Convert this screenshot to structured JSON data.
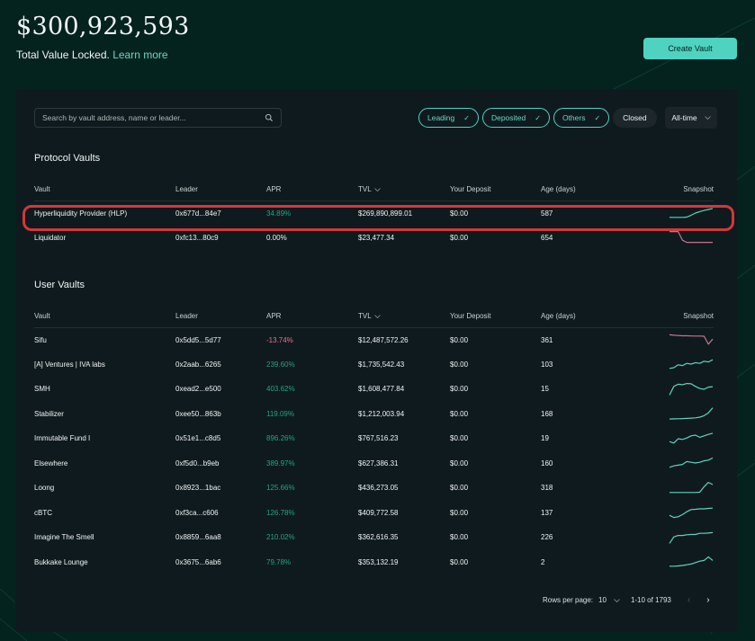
{
  "header": {
    "total_value_locked": "$300,923,593",
    "subtitle": "Total Value Locked.",
    "learn_more": "Learn more"
  },
  "create_vault_label": "Create Vault",
  "search": {
    "placeholder": "Search by vault address, name or leader...",
    "value": ""
  },
  "filters": [
    {
      "label": "Leading",
      "checked": true
    },
    {
      "label": "Deposited",
      "checked": true
    },
    {
      "label": "Others",
      "checked": true
    },
    {
      "label": "Closed",
      "checked": false
    }
  ],
  "time_range": "All-time",
  "columns": [
    "Vault",
    "Leader",
    "APR",
    "TVL",
    "Your Deposit",
    "Age (days)",
    "Snapshot"
  ],
  "colors": {
    "accent": "#50d2c1",
    "positive": "#1fa67d",
    "negative": "#ed7088",
    "highlight": "#d3373a"
  },
  "protocol_vaults": {
    "title": "Protocol Vaults",
    "rows": [
      {
        "vault": "Hyperliquidity Provider (HLP)",
        "leader": "0x677d...84e7",
        "apr": "34.89%",
        "apr_sign": "pos",
        "tvl": "$269,890,899.01",
        "deposit": "$0.00",
        "age": "587",
        "trend": "up",
        "snapshot": [
          0.2,
          0.2,
          0.2,
          0.2,
          0.22,
          0.35,
          0.5,
          0.6,
          0.68,
          0.75,
          0.82
        ]
      },
      {
        "vault": "Liquidator",
        "leader": "0xfc13...80c9",
        "apr": "0.00%",
        "apr_sign": "neutral",
        "tvl": "$23,477.34",
        "deposit": "$0.00",
        "age": "654",
        "trend": "down",
        "snapshot": [
          0.9,
          0.9,
          0.9,
          0.3,
          0.15,
          0.15,
          0.15,
          0.15,
          0.15,
          0.15,
          0.15
        ]
      }
    ]
  },
  "user_vaults": {
    "title": "User Vaults",
    "rows": [
      {
        "vault": "Sifu",
        "leader": "0x5dd5...5d77",
        "apr": "-13.74%",
        "apr_sign": "neg",
        "tvl": "$12,487,572.26",
        "deposit": "$0.00",
        "age": "361",
        "trend": "down",
        "snapshot": [
          0.85,
          0.82,
          0.8,
          0.78,
          0.78,
          0.77,
          0.76,
          0.76,
          0.75,
          0.2,
          0.55
        ]
      },
      {
        "vault": "[A] Ventures | IVA labs",
        "leader": "0x2aab...6265",
        "apr": "239.60%",
        "apr_sign": "pos",
        "tvl": "$1,735,542.43",
        "deposit": "$0.00",
        "age": "103",
        "trend": "up",
        "snapshot": [
          0.2,
          0.25,
          0.45,
          0.4,
          0.55,
          0.5,
          0.6,
          0.55,
          0.7,
          0.65,
          0.8
        ]
      },
      {
        "vault": "SMH",
        "leader": "0xead2...e500",
        "apr": "403.62%",
        "apr_sign": "pos",
        "tvl": "$1,608,477.84",
        "deposit": "$0.00",
        "age": "15",
        "trend": "up",
        "snapshot": [
          0.1,
          0.7,
          0.85,
          0.82,
          0.9,
          0.88,
          0.7,
          0.55,
          0.5,
          0.65,
          0.68
        ]
      },
      {
        "vault": "Stabilizer",
        "leader": "0xee50...863b",
        "apr": "119.09%",
        "apr_sign": "pos",
        "tvl": "$1,212,003.94",
        "deposit": "$0.00",
        "age": "168",
        "trend": "up",
        "snapshot": [
          0.12,
          0.13,
          0.14,
          0.15,
          0.16,
          0.18,
          0.2,
          0.25,
          0.35,
          0.55,
          0.9
        ]
      },
      {
        "vault": "Immutable Fund I",
        "leader": "0x51e1...c8d5",
        "apr": "896.26%",
        "apr_sign": "pos",
        "tvl": "$767,516.23",
        "deposit": "$0.00",
        "age": "19",
        "trend": "up",
        "snapshot": [
          0.3,
          0.2,
          0.5,
          0.45,
          0.55,
          0.7,
          0.75,
          0.6,
          0.7,
          0.8,
          0.88
        ]
      },
      {
        "vault": "Elsewhere",
        "leader": "0xf5d0...b9eb",
        "apr": "389.97%",
        "apr_sign": "pos",
        "tvl": "$627,386.31",
        "deposit": "$0.00",
        "age": "160",
        "trend": "up",
        "snapshot": [
          0.2,
          0.3,
          0.35,
          0.4,
          0.6,
          0.55,
          0.5,
          0.55,
          0.65,
          0.7,
          0.85
        ]
      },
      {
        "vault": "Loong",
        "leader": "0x8923...1bac",
        "apr": "125.66%",
        "apr_sign": "pos",
        "tvl": "$436,273.05",
        "deposit": "$0.00",
        "age": "318",
        "trend": "up",
        "snapshot": [
          0.2,
          0.2,
          0.2,
          0.2,
          0.2,
          0.2,
          0.2,
          0.22,
          0.6,
          0.9,
          0.75
        ]
      },
      {
        "vault": "cBTC",
        "leader": "0xf3ca...c606",
        "apr": "126.78%",
        "apr_sign": "pos",
        "tvl": "$409,772.58",
        "deposit": "$0.00",
        "age": "137",
        "trend": "up",
        "snapshot": [
          0.3,
          0.15,
          0.2,
          0.35,
          0.55,
          0.7,
          0.72,
          0.75,
          0.75,
          0.78,
          0.8
        ]
      },
      {
        "vault": "Imagine The Smell",
        "leader": "0x8859...6aa8",
        "apr": "210.02%",
        "apr_sign": "pos",
        "tvl": "$362,616.35",
        "deposit": "$0.00",
        "age": "226",
        "trend": "up",
        "snapshot": [
          0.1,
          0.55,
          0.65,
          0.65,
          0.7,
          0.72,
          0.72,
          0.8,
          0.8,
          0.82,
          0.85
        ]
      },
      {
        "vault": "Bukkake Lounge",
        "leader": "0x3675...6ab6",
        "apr": "79.78%",
        "apr_sign": "pos",
        "tvl": "$353,132.19",
        "deposit": "$0.00",
        "age": "2",
        "trend": "up",
        "snapshot": [
          0.2,
          0.2,
          0.22,
          0.25,
          0.3,
          0.35,
          0.45,
          0.55,
          0.6,
          0.85,
          0.6
        ]
      }
    ]
  },
  "pagination": {
    "rows_per_page_label": "Rows per page:",
    "rows_per_page": "10",
    "range": "1-10 of 1793",
    "prev": "‹",
    "next": "›"
  }
}
